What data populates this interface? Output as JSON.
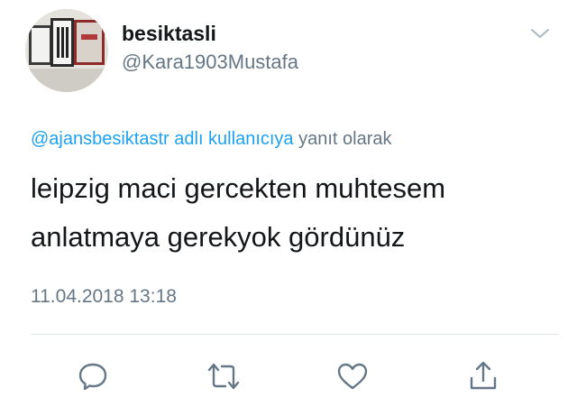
{
  "user": {
    "display_name": "besiktasli",
    "handle": "@Kara1903Mustafa",
    "avatar_icon": "avatar-framed-pictures"
  },
  "reply": {
    "mention": "@ajansbesiktastr adlı kullanıcıya",
    "suffix": "yanıt olarak"
  },
  "tweet": {
    "lines": [
      "leipzig maci gercekten muhtesem",
      "anlatmaya gerekyok gördünüz"
    ]
  },
  "timestamp": "11.04.2018 13:18",
  "actions": {
    "reply_icon": "speech-bubble",
    "retweet_icon": "retweet-arrows",
    "like_icon": "heart",
    "share_icon": "share-upload"
  },
  "colors": {
    "accent": "#1da1f2",
    "muted": "#657786",
    "icon": "#657786",
    "divider": "#e1e8ed",
    "text": "#14171a"
  }
}
